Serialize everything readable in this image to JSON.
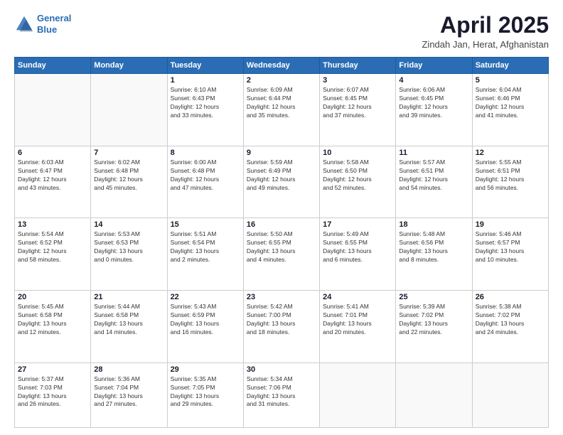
{
  "logo": {
    "line1": "General",
    "line2": "Blue"
  },
  "title": "April 2025",
  "subtitle": "Zindah Jan, Herat, Afghanistan",
  "weekdays": [
    "Sunday",
    "Monday",
    "Tuesday",
    "Wednesday",
    "Thursday",
    "Friday",
    "Saturday"
  ],
  "weeks": [
    [
      {
        "day": "",
        "info": ""
      },
      {
        "day": "",
        "info": ""
      },
      {
        "day": "1",
        "info": "Sunrise: 6:10 AM\nSunset: 6:43 PM\nDaylight: 12 hours\nand 33 minutes."
      },
      {
        "day": "2",
        "info": "Sunrise: 6:09 AM\nSunset: 6:44 PM\nDaylight: 12 hours\nand 35 minutes."
      },
      {
        "day": "3",
        "info": "Sunrise: 6:07 AM\nSunset: 6:45 PM\nDaylight: 12 hours\nand 37 minutes."
      },
      {
        "day": "4",
        "info": "Sunrise: 6:06 AM\nSunset: 6:45 PM\nDaylight: 12 hours\nand 39 minutes."
      },
      {
        "day": "5",
        "info": "Sunrise: 6:04 AM\nSunset: 6:46 PM\nDaylight: 12 hours\nand 41 minutes."
      }
    ],
    [
      {
        "day": "6",
        "info": "Sunrise: 6:03 AM\nSunset: 6:47 PM\nDaylight: 12 hours\nand 43 minutes."
      },
      {
        "day": "7",
        "info": "Sunrise: 6:02 AM\nSunset: 6:48 PM\nDaylight: 12 hours\nand 45 minutes."
      },
      {
        "day": "8",
        "info": "Sunrise: 6:00 AM\nSunset: 6:48 PM\nDaylight: 12 hours\nand 47 minutes."
      },
      {
        "day": "9",
        "info": "Sunrise: 5:59 AM\nSunset: 6:49 PM\nDaylight: 12 hours\nand 49 minutes."
      },
      {
        "day": "10",
        "info": "Sunrise: 5:58 AM\nSunset: 6:50 PM\nDaylight: 12 hours\nand 52 minutes."
      },
      {
        "day": "11",
        "info": "Sunrise: 5:57 AM\nSunset: 6:51 PM\nDaylight: 12 hours\nand 54 minutes."
      },
      {
        "day": "12",
        "info": "Sunrise: 5:55 AM\nSunset: 6:51 PM\nDaylight: 12 hours\nand 56 minutes."
      }
    ],
    [
      {
        "day": "13",
        "info": "Sunrise: 5:54 AM\nSunset: 6:52 PM\nDaylight: 12 hours\nand 58 minutes."
      },
      {
        "day": "14",
        "info": "Sunrise: 5:53 AM\nSunset: 6:53 PM\nDaylight: 13 hours\nand 0 minutes."
      },
      {
        "day": "15",
        "info": "Sunrise: 5:51 AM\nSunset: 6:54 PM\nDaylight: 13 hours\nand 2 minutes."
      },
      {
        "day": "16",
        "info": "Sunrise: 5:50 AM\nSunset: 6:55 PM\nDaylight: 13 hours\nand 4 minutes."
      },
      {
        "day": "17",
        "info": "Sunrise: 5:49 AM\nSunset: 6:55 PM\nDaylight: 13 hours\nand 6 minutes."
      },
      {
        "day": "18",
        "info": "Sunrise: 5:48 AM\nSunset: 6:56 PM\nDaylight: 13 hours\nand 8 minutes."
      },
      {
        "day": "19",
        "info": "Sunrise: 5:46 AM\nSunset: 6:57 PM\nDaylight: 13 hours\nand 10 minutes."
      }
    ],
    [
      {
        "day": "20",
        "info": "Sunrise: 5:45 AM\nSunset: 6:58 PM\nDaylight: 13 hours\nand 12 minutes."
      },
      {
        "day": "21",
        "info": "Sunrise: 5:44 AM\nSunset: 6:58 PM\nDaylight: 13 hours\nand 14 minutes."
      },
      {
        "day": "22",
        "info": "Sunrise: 5:43 AM\nSunset: 6:59 PM\nDaylight: 13 hours\nand 16 minutes."
      },
      {
        "day": "23",
        "info": "Sunrise: 5:42 AM\nSunset: 7:00 PM\nDaylight: 13 hours\nand 18 minutes."
      },
      {
        "day": "24",
        "info": "Sunrise: 5:41 AM\nSunset: 7:01 PM\nDaylight: 13 hours\nand 20 minutes."
      },
      {
        "day": "25",
        "info": "Sunrise: 5:39 AM\nSunset: 7:02 PM\nDaylight: 13 hours\nand 22 minutes."
      },
      {
        "day": "26",
        "info": "Sunrise: 5:38 AM\nSunset: 7:02 PM\nDaylight: 13 hours\nand 24 minutes."
      }
    ],
    [
      {
        "day": "27",
        "info": "Sunrise: 5:37 AM\nSunset: 7:03 PM\nDaylight: 13 hours\nand 26 minutes."
      },
      {
        "day": "28",
        "info": "Sunrise: 5:36 AM\nSunset: 7:04 PM\nDaylight: 13 hours\nand 27 minutes."
      },
      {
        "day": "29",
        "info": "Sunrise: 5:35 AM\nSunset: 7:05 PM\nDaylight: 13 hours\nand 29 minutes."
      },
      {
        "day": "30",
        "info": "Sunrise: 5:34 AM\nSunset: 7:06 PM\nDaylight: 13 hours\nand 31 minutes."
      },
      {
        "day": "",
        "info": ""
      },
      {
        "day": "",
        "info": ""
      },
      {
        "day": "",
        "info": ""
      }
    ]
  ]
}
